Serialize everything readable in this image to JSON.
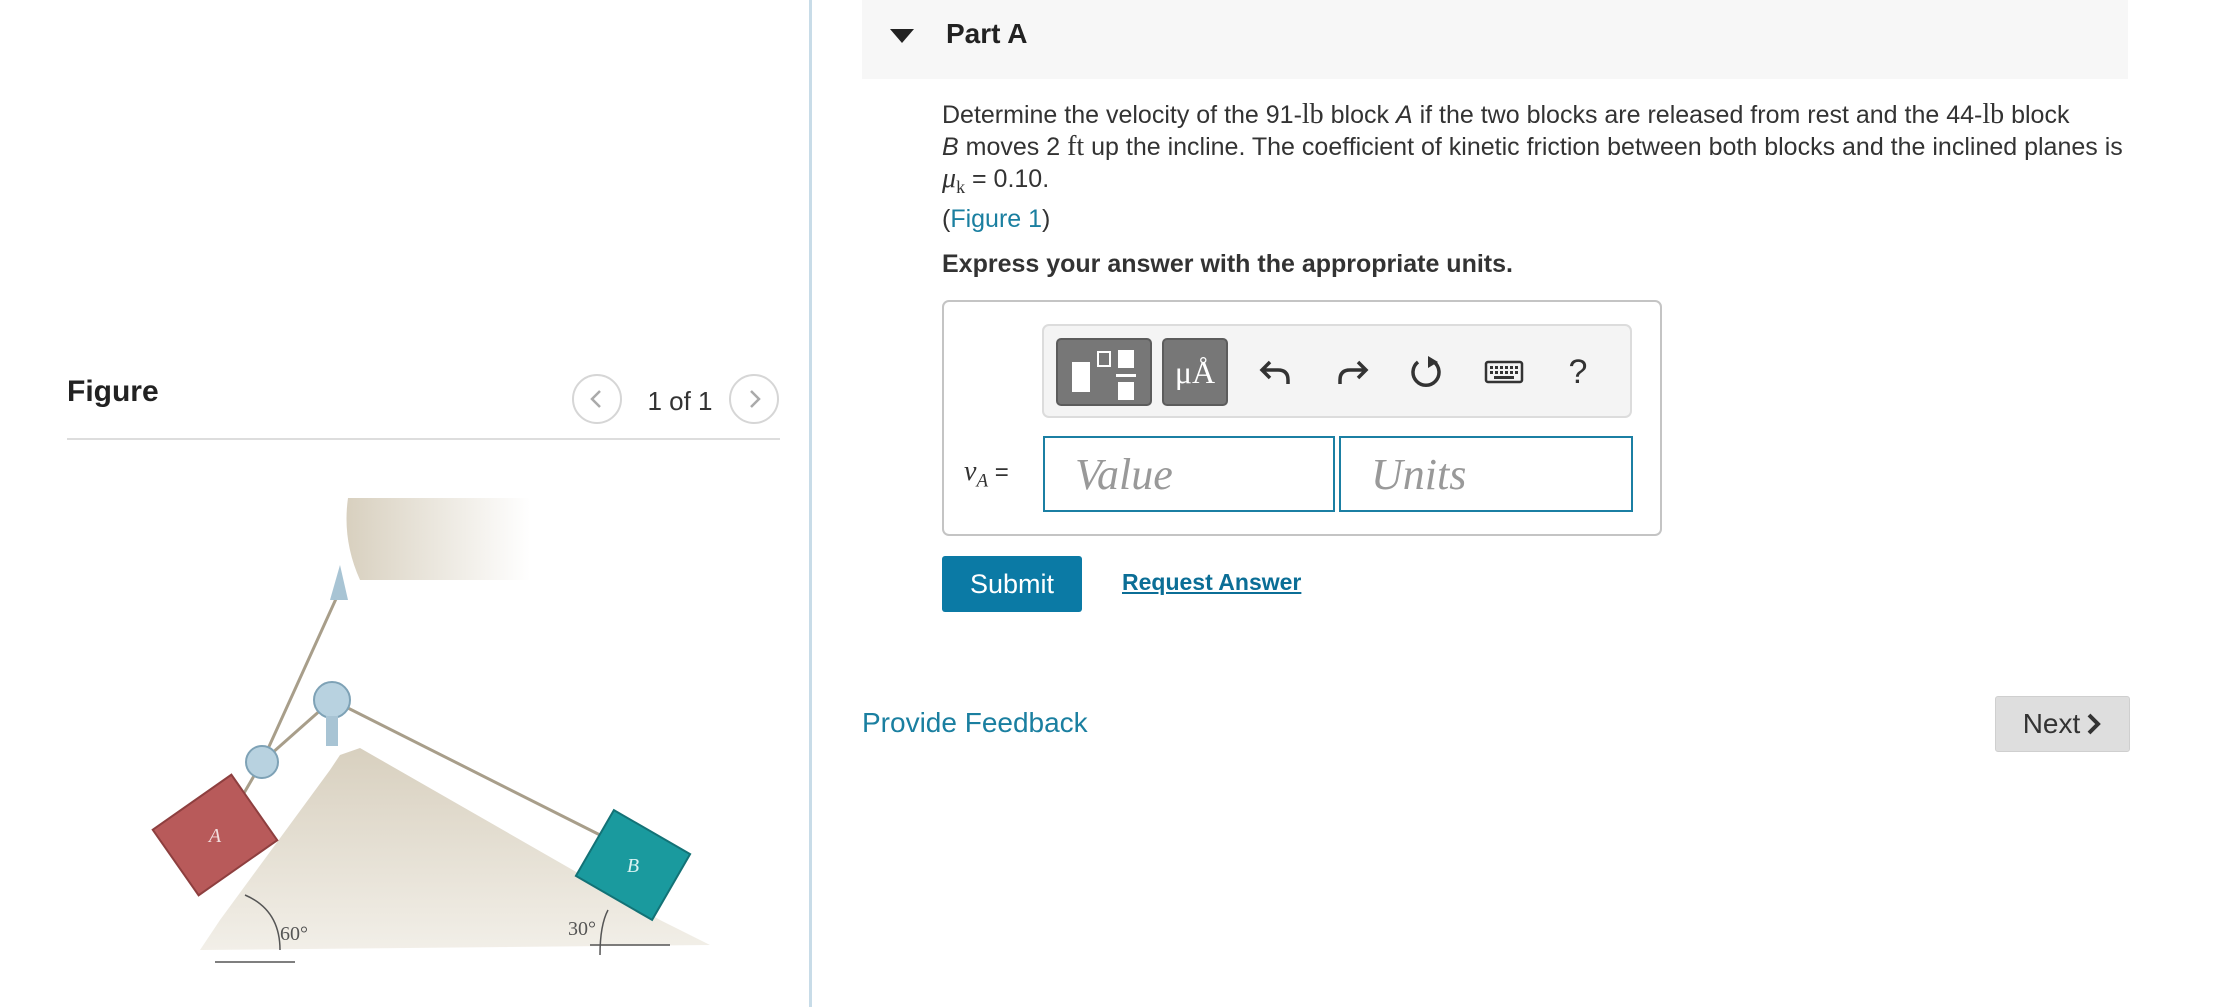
{
  "figure_panel": {
    "heading": "Figure",
    "counter": "1 of 1",
    "diagram": {
      "block_a_label": "A",
      "block_b_label": "B",
      "angle_left": "60°",
      "angle_right": "30°",
      "block_a_color": "#b85a5a",
      "block_b_color": "#1a9a9e",
      "incline_color": "#d8d0bf"
    }
  },
  "part": {
    "title": "Part A",
    "question": {
      "t1": "Determine the velocity of the 91-",
      "u1": "lb",
      "t2": " block ",
      "v1": "A",
      "t3": " if the two blocks are released from rest and the 44-",
      "u2": "lb",
      "t4": " block ",
      "v2": "B",
      "t5": " moves 2 ",
      "u3": "ft",
      "t6": " up the incline. The coefficient of kinetic friction between both blocks and the inclined planes is ",
      "mu": "μ",
      "mu_sub": "k",
      "t7": " = 0.10.",
      "paren_open": "(",
      "figure_link": "Figure 1",
      "paren_close": ")"
    },
    "instruction": "Express your answer with the appropriate units."
  },
  "toolbar": {
    "symbols_label": "μÅ",
    "help_label": "?",
    "icons": [
      "templates-icon",
      "undo-icon",
      "redo-icon",
      "reset-icon",
      "keyboard-icon",
      "help-icon"
    ]
  },
  "answer": {
    "variable": "v",
    "variable_sub": "A",
    "equals": " =",
    "value_placeholder": "Value",
    "units_placeholder": "Units"
  },
  "actions": {
    "submit": "Submit",
    "request_answer": "Request Answer",
    "provide_feedback": "Provide Feedback",
    "next": "Next"
  },
  "colors": {
    "accent": "#0b7aa5",
    "link": "#1a7fa0",
    "input_border": "#1b7fa3"
  }
}
